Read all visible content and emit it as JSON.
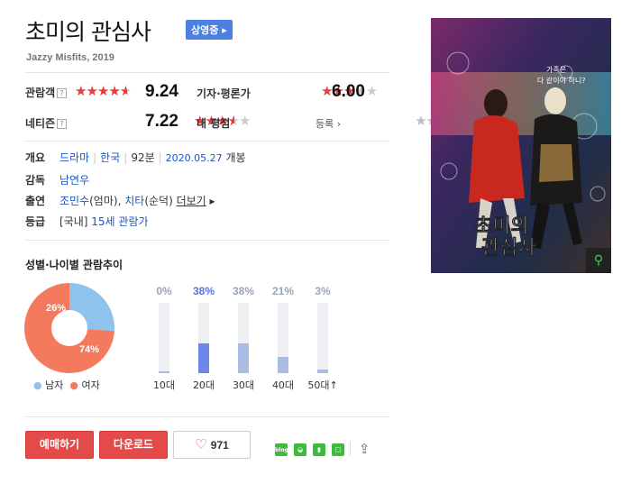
{
  "movie": {
    "title": "초미의 관심사",
    "status": "상영중",
    "subtitle": "Jazzy Misfits, 2019"
  },
  "ratings": {
    "audience": {
      "label": "관람객",
      "score": "9.24",
      "level": 0.924
    },
    "critic": {
      "label": "기자·평론가",
      "score": "6.00",
      "level": 0.6
    },
    "netizen": {
      "label": "네티즌",
      "score": "7.22",
      "level": 0.722
    },
    "mine": {
      "label": "내 평점",
      "action": "등록"
    },
    "help_mark": "?"
  },
  "info": {
    "summary_label": "개요",
    "genre": "드라마",
    "country": "한국",
    "runtime": "92분",
    "release_date": "2020.05.27",
    "release_suffix": "개봉",
    "director_label": "감독",
    "director": "남연우",
    "cast_label": "출연",
    "cast1": "조민수",
    "cast1_role": "(엄마)",
    "cast2": "치타",
    "cast2_role": "(순덕)",
    "more": "더보기",
    "rating_label": "등급",
    "rating_prefix": "[국내]",
    "rating_value": "15세 관람가"
  },
  "demographics": {
    "heading": "성별·나이별 관람추이",
    "gender": {
      "male_pct": "26%",
      "female_pct": "74%",
      "male_value": 26,
      "female_value": 74,
      "male_label": "남자",
      "female_label": "여자",
      "male_color": "#8fc3ee",
      "female_color": "#f47a5e"
    },
    "ages": [
      {
        "label": "10대",
        "pct": "0%",
        "value": 0
      },
      {
        "label": "20대",
        "pct": "38%",
        "value": 38
      },
      {
        "label": "30대",
        "pct": "38%",
        "value": 38
      },
      {
        "label": "40대",
        "pct": "21%",
        "value": 21
      },
      {
        "label": "50대↑",
        "pct": "3%",
        "value": 3
      }
    ]
  },
  "actions": {
    "book": "예매하기",
    "download": "다운로드",
    "likes": "971"
  },
  "share": {
    "blog": "blog",
    "icons": [
      "blog-icon",
      "band-icon",
      "bookmark-icon",
      "square-icon",
      "share-icon"
    ]
  },
  "poster": {
    "title_line1": "초미의",
    "title_line2": "관심사",
    "tagline": "가족은\n다 같이야 하니?"
  }
}
